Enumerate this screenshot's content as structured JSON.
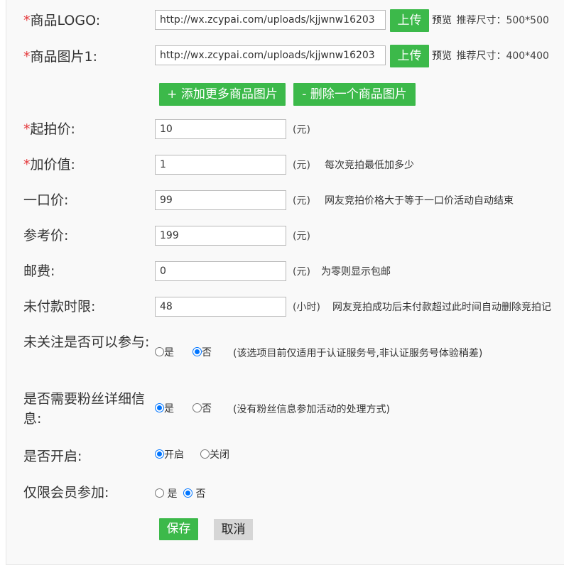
{
  "fields": {
    "logo": {
      "required": "*",
      "label": "商品LOGO:",
      "value": "http://wx.zcypai.com/uploads/kjjwnw16203",
      "upload": "上传",
      "preview": "预览",
      "hint": "推荐尺寸：500*500"
    },
    "image1": {
      "required": "*",
      "label": "商品图片1:",
      "value": "http://wx.zcypai.com/uploads/kjjwnw16203",
      "upload": "上传",
      "preview": "预览",
      "hint": "推荐尺寸：400*400"
    },
    "image_actions": {
      "add": "+ 添加更多商品图片",
      "remove": "- 删除一个商品图片"
    },
    "start_price": {
      "required": "*",
      "label": "起拍价:",
      "value": "10",
      "unit": "(元)"
    },
    "increment": {
      "required": "*",
      "label": "加价值:",
      "value": "1",
      "unit": "(元)",
      "hint": "每次竞拍最低加多少"
    },
    "buyout": {
      "label": "一口价:",
      "value": "99",
      "unit": "(元)",
      "hint": "网友竞拍价格大于等于一口价活动自动结束"
    },
    "reference": {
      "label": "参考价:",
      "value": "199",
      "unit": "(元)"
    },
    "shipping": {
      "label": "邮费:",
      "value": "0",
      "unit": "(元)",
      "hint": "为零则显示包邮"
    },
    "pay_limit": {
      "label": "未付款时限:",
      "value": "48",
      "unit": "(小时)",
      "hint": "网友竞拍成功后未付款超过此时间自动删除竞拍记"
    }
  },
  "radios": {
    "follow": {
      "label": "未关注是否可以参与:",
      "yes": "是",
      "no": "否",
      "selected": "否",
      "hint": "(该选项目前仅适用于认证服务号,非认证服务号体验稍差)"
    },
    "fan_info": {
      "label": "是否需要粉丝详细信息:",
      "yes": "是",
      "no": "否",
      "selected": "是",
      "hint": "(没有粉丝信息参加活动的处理方式)"
    },
    "enabled": {
      "label": "是否开启:",
      "on": "开启",
      "off": "关闭",
      "selected": "开启"
    },
    "members_only": {
      "label": "仅限会员参加:",
      "yes": "是",
      "no": "否",
      "selected": "否"
    }
  },
  "actions": {
    "save": "保存",
    "cancel": "取消"
  }
}
